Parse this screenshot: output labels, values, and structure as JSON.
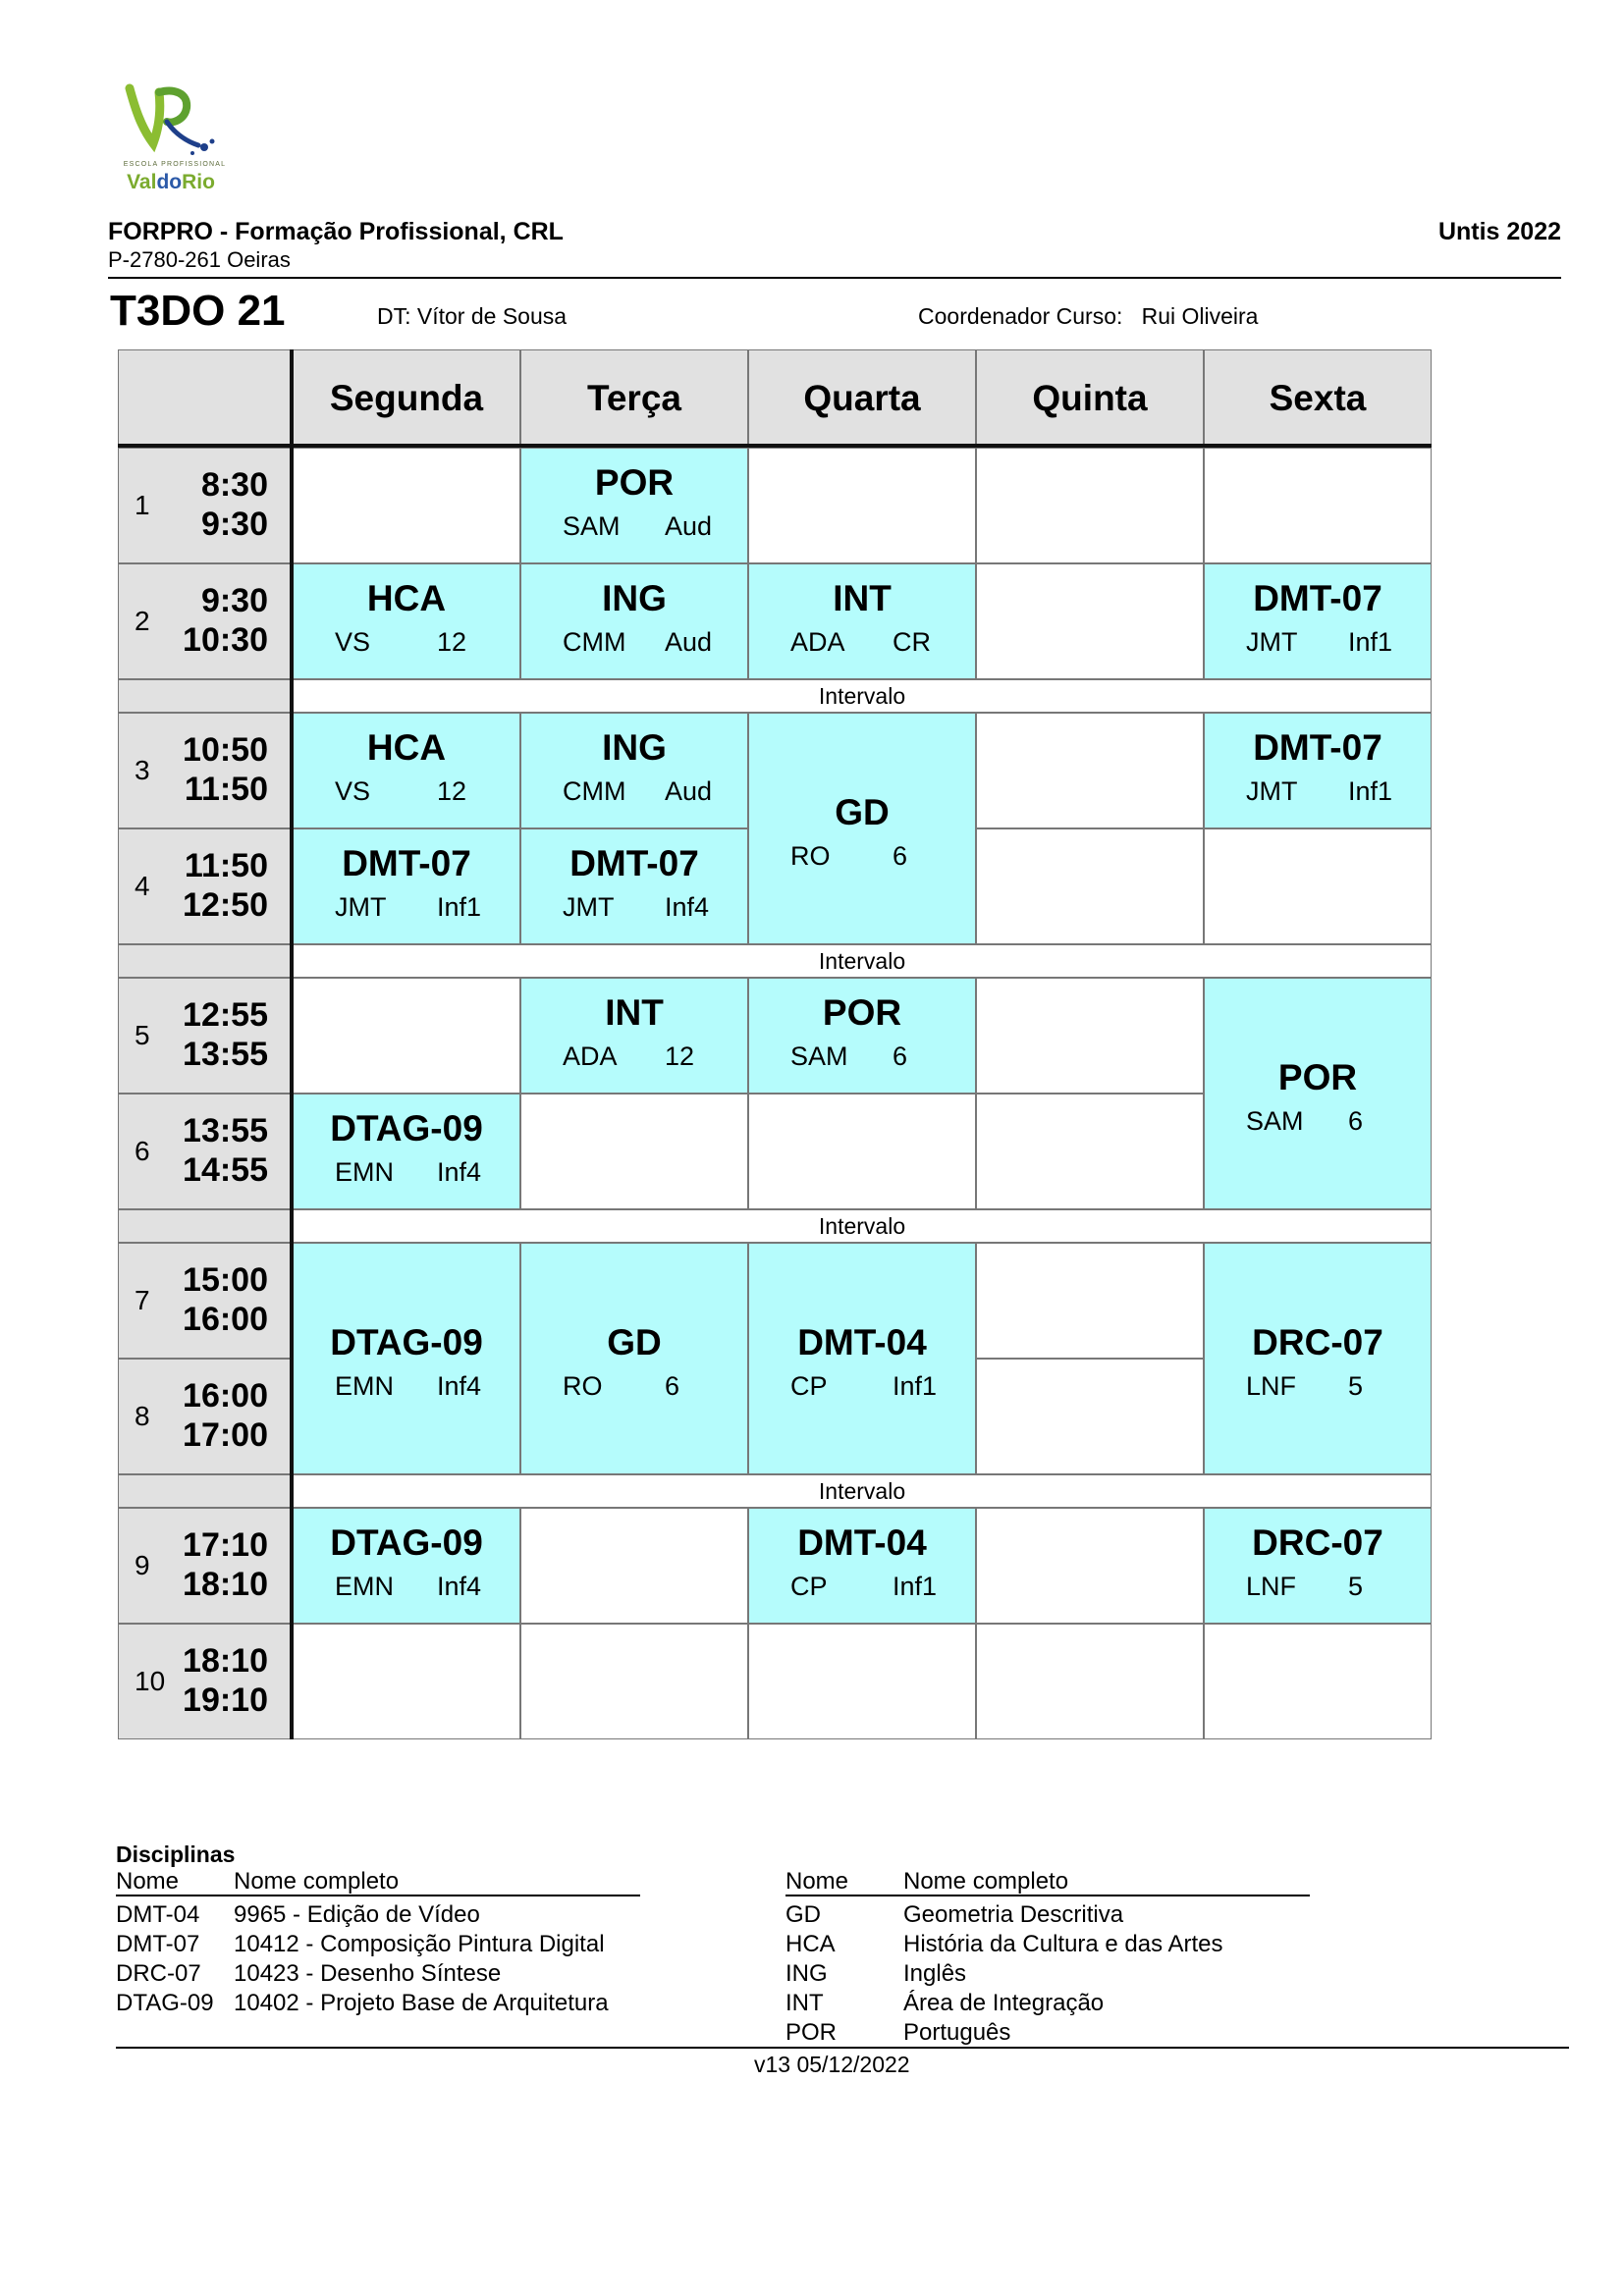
{
  "logo": {
    "tagline": "ESCOLA PROFISSIONAL",
    "name": "ValdoRio",
    "mark": "VR"
  },
  "header": {
    "org": "FORPRO - Formação Profissional, CRL",
    "address": "P-2780-261 Oeiras",
    "software": "Untis 2022"
  },
  "class_info": {
    "class_name": "T3DO 21",
    "dt_label": "DT:",
    "dt_name": "Vítor de Sousa",
    "coord_label": "Coordenador Curso:",
    "coord_name": "Rui Oliveira"
  },
  "timetable": {
    "days": [
      "Segunda",
      "Terça",
      "Quarta",
      "Quinta",
      "Sexta"
    ],
    "break_label": "Intervalo",
    "periods": [
      {
        "n": "1",
        "start": "8:30",
        "end": "9:30"
      },
      {
        "n": "2",
        "start": "9:30",
        "end": "10:30"
      },
      {
        "n": "3",
        "start": "10:50",
        "end": "11:50"
      },
      {
        "n": "4",
        "start": "11:50",
        "end": "12:50"
      },
      {
        "n": "5",
        "start": "12:55",
        "end": "13:55"
      },
      {
        "n": "6",
        "start": "13:55",
        "end": "14:55"
      },
      {
        "n": "7",
        "start": "15:00",
        "end": "16:00"
      },
      {
        "n": "8",
        "start": "16:00",
        "end": "17:00"
      },
      {
        "n": "9",
        "start": "17:10",
        "end": "18:10"
      },
      {
        "n": "10",
        "start": "18:10",
        "end": "19:10"
      }
    ],
    "lessons": [
      {
        "day": 1,
        "period": 1,
        "span": 1,
        "subject": "POR",
        "teacher": "SAM",
        "room": "Aud"
      },
      {
        "day": 0,
        "period": 2,
        "span": 1,
        "subject": "HCA",
        "teacher": "VS",
        "room": "12"
      },
      {
        "day": 1,
        "period": 2,
        "span": 1,
        "subject": "ING",
        "teacher": "CMM",
        "room": "Aud"
      },
      {
        "day": 2,
        "period": 2,
        "span": 1,
        "subject": "INT",
        "teacher": "ADA",
        "room": "CR"
      },
      {
        "day": 4,
        "period": 2,
        "span": 1,
        "subject": "DMT-07",
        "teacher": "JMT",
        "room": "Inf1"
      },
      {
        "day": 0,
        "period": 3,
        "span": 1,
        "subject": "HCA",
        "teacher": "VS",
        "room": "12"
      },
      {
        "day": 1,
        "period": 3,
        "span": 1,
        "subject": "ING",
        "teacher": "CMM",
        "room": "Aud"
      },
      {
        "day": 2,
        "period": 3,
        "span": 2,
        "subject": "GD",
        "teacher": "RO",
        "room": "6"
      },
      {
        "day": 4,
        "period": 3,
        "span": 1,
        "subject": "DMT-07",
        "teacher": "JMT",
        "room": "Inf1"
      },
      {
        "day": 0,
        "period": 4,
        "span": 1,
        "subject": "DMT-07",
        "teacher": "JMT",
        "room": "Inf1"
      },
      {
        "day": 1,
        "period": 4,
        "span": 1,
        "subject": "DMT-07",
        "teacher": "JMT",
        "room": "Inf4"
      },
      {
        "day": 1,
        "period": 5,
        "span": 1,
        "subject": "INT",
        "teacher": "ADA",
        "room": "12"
      },
      {
        "day": 2,
        "period": 5,
        "span": 1,
        "subject": "POR",
        "teacher": "SAM",
        "room": "6"
      },
      {
        "day": 4,
        "period": 5,
        "span": 2,
        "subject": "POR",
        "teacher": "SAM",
        "room": "6"
      },
      {
        "day": 0,
        "period": 6,
        "span": 1,
        "subject": "DTAG-09",
        "teacher": "EMN",
        "room": "Inf4"
      },
      {
        "day": 0,
        "period": 7,
        "span": 2,
        "subject": "DTAG-09",
        "teacher": "EMN",
        "room": "Inf4"
      },
      {
        "day": 1,
        "period": 7,
        "span": 2,
        "subject": "GD",
        "teacher": "RO",
        "room": "6"
      },
      {
        "day": 2,
        "period": 7,
        "span": 2,
        "subject": "DMT-04",
        "teacher": "CP",
        "room": "Inf1"
      },
      {
        "day": 4,
        "period": 7,
        "span": 2,
        "subject": "DRC-07",
        "teacher": "LNF",
        "room": "5"
      },
      {
        "day": 0,
        "period": 9,
        "span": 1,
        "subject": "DTAG-09",
        "teacher": "EMN",
        "room": "Inf4"
      },
      {
        "day": 2,
        "period": 9,
        "span": 1,
        "subject": "DMT-04",
        "teacher": "CP",
        "room": "Inf1"
      },
      {
        "day": 4,
        "period": 9,
        "span": 1,
        "subject": "DRC-07",
        "teacher": "LNF",
        "room": "5"
      }
    ]
  },
  "legend": {
    "title": "Disciplinas",
    "col_short": "Nome",
    "col_full": "Nome completo",
    "left": [
      {
        "code": "DMT-04",
        "name": "9965 - Edição de Vídeo"
      },
      {
        "code": "DMT-07",
        "name": "10412 - Composição Pintura Digital"
      },
      {
        "code": "DRC-07",
        "name": "10423 - Desenho Síntese"
      },
      {
        "code": "DTAG-09",
        "name": "10402 - Projeto Base de Arquitetura"
      }
    ],
    "right": [
      {
        "code": "GD",
        "name": "Geometria Descritiva"
      },
      {
        "code": "HCA",
        "name": "História da Cultura e das Artes"
      },
      {
        "code": "ING",
        "name": "Inglês"
      },
      {
        "code": "INT",
        "name": "Área de Integração"
      },
      {
        "code": "POR",
        "name": "Português"
      }
    ]
  },
  "footer": {
    "version": "v13 05/12/2022"
  },
  "colors": {
    "lesson_bg": "#b5fcfc",
    "header_bg": "#e1e1e1",
    "logo_green": "#7bab2e"
  }
}
